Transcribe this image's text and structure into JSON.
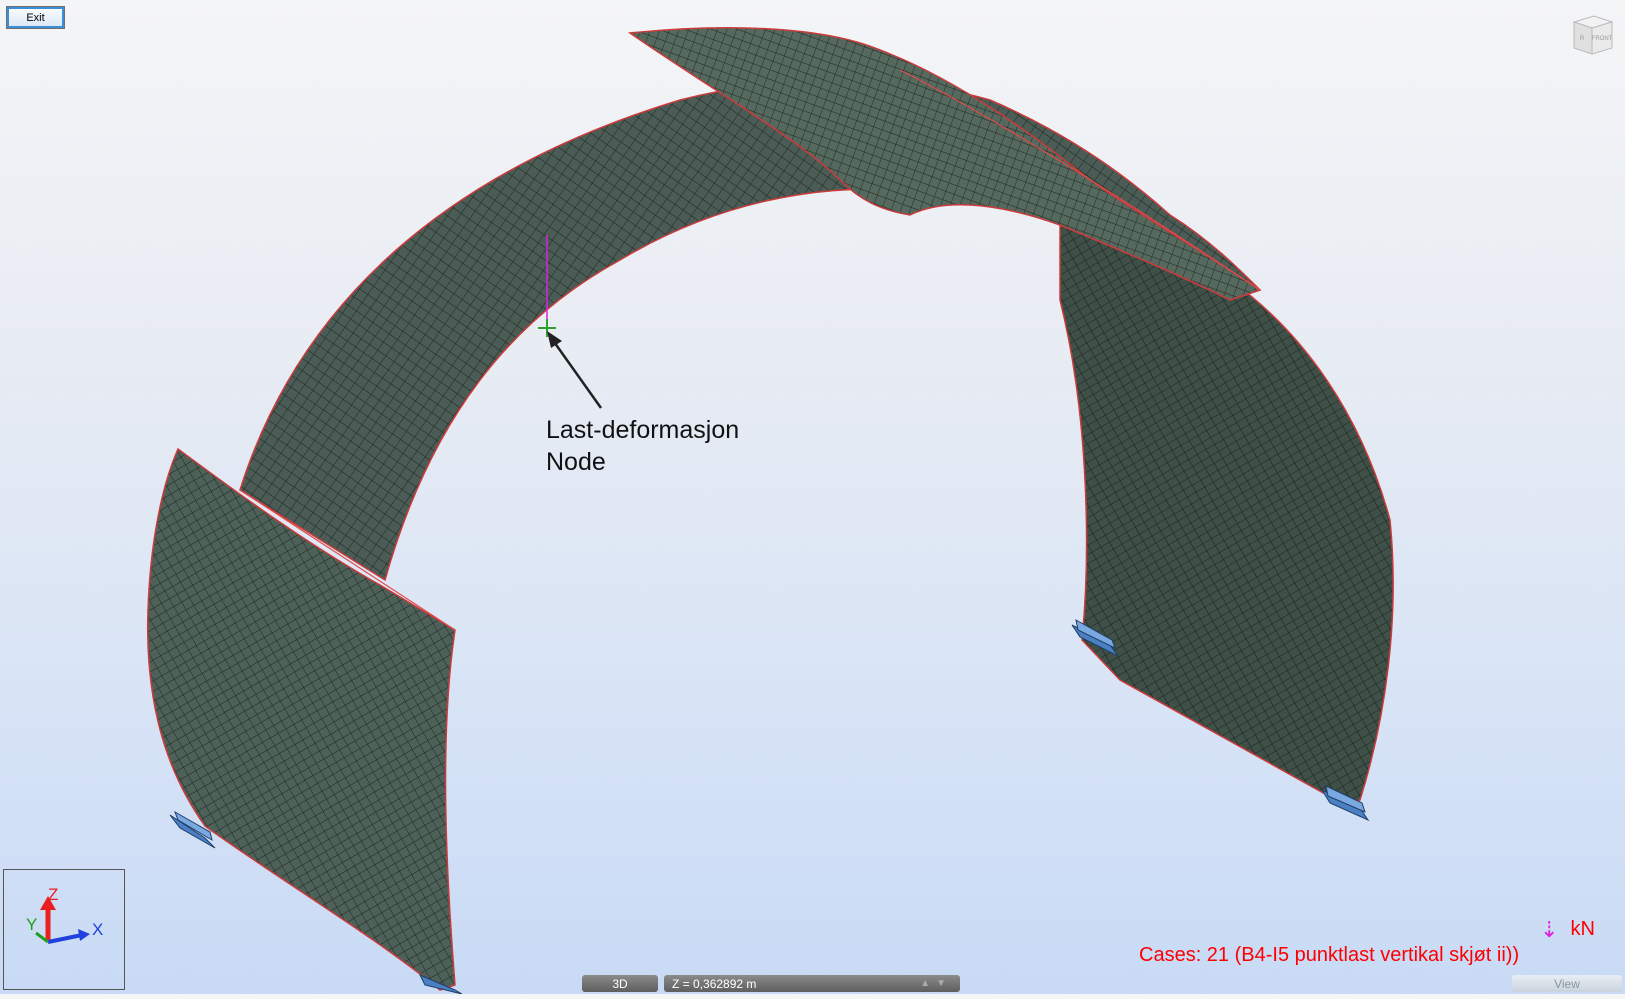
{
  "toolbar": {
    "exit_label": "Exit"
  },
  "view_cube": {
    "face_label": "FRONT",
    "side_label": "R"
  },
  "axes": {
    "z": "Z",
    "y": "Y",
    "x": "X",
    "colors": {
      "z": "#e82020",
      "y": "#20a020",
      "x": "#2040e0"
    }
  },
  "annotation": {
    "line1": "Last-deformasjon",
    "line2": "Node"
  },
  "load": {
    "arrow": "⇣",
    "unit": "kN",
    "color": "#ff0000"
  },
  "cases": {
    "text": "Cases: 21 (B4-I5 punktlast vertikal skjøt ii))"
  },
  "status": {
    "mode": "3D",
    "z_value": "Z = 0,362892 m",
    "view_label": "View"
  },
  "colors": {
    "mesh_fill": "#4c5e56",
    "mesh_line": "#1f2a1f",
    "edge": "#d04040",
    "support": "#4a7fc1"
  }
}
